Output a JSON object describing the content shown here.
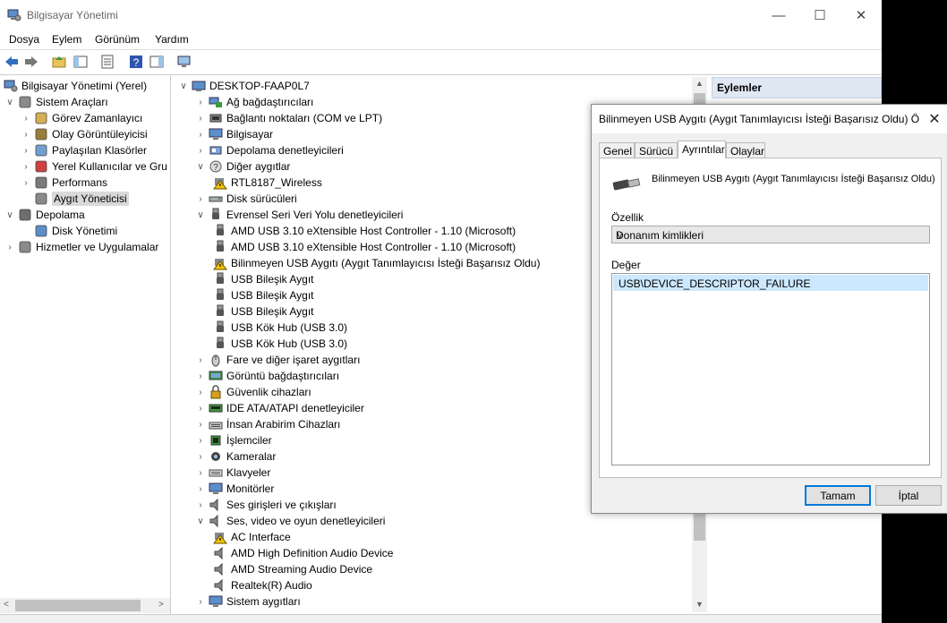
{
  "window": {
    "title": "Bilgisayar Yönetimi",
    "controls": {
      "minimize": "—",
      "maximize": "☐",
      "close": "✕"
    }
  },
  "menu": [
    "Dosya",
    "Eylem",
    "Görünüm",
    "Yardım"
  ],
  "tree": {
    "root": "Bilgisayar Yönetimi (Yerel)",
    "items": [
      {
        "label": "Sistem Araçları",
        "level": 1,
        "expanded": true
      },
      {
        "label": "Görev Zamanlayıcı",
        "level": 2
      },
      {
        "label": "Olay Görüntüleyicisi",
        "level": 2
      },
      {
        "label": "Paylaşılan Klasörler",
        "level": 2
      },
      {
        "label": "Yerel Kullanıcılar ve Gru",
        "level": 2
      },
      {
        "label": "Performans",
        "level": 2
      },
      {
        "label": "Aygıt Yöneticisi",
        "level": 2,
        "selected": true
      },
      {
        "label": "Depolama",
        "level": 1,
        "expanded": true
      },
      {
        "label": "Disk Yönetimi",
        "level": 2
      },
      {
        "label": "Hizmetler ve Uygulamalar",
        "level": 1
      }
    ]
  },
  "devices": {
    "computer": "DESKTOP-FAAP0L7",
    "rows": [
      {
        "label": "Ağ bağdaştırıcıları",
        "indent": 1,
        "arrow": ">",
        "icon": "network"
      },
      {
        "label": "Bağlantı noktaları (COM ve LPT)",
        "indent": 1,
        "arrow": ">",
        "icon": "port"
      },
      {
        "label": "Bilgisayar",
        "indent": 1,
        "arrow": ">",
        "icon": "monitor"
      },
      {
        "label": "Depolama denetleyicileri",
        "indent": 1,
        "arrow": ">",
        "icon": "storage"
      },
      {
        "label": "Diğer aygıtlar",
        "indent": 1,
        "arrow": "v",
        "icon": "unknown"
      },
      {
        "label": "RTL8187_Wireless",
        "indent": 2,
        "arrow": "",
        "icon": "warning"
      },
      {
        "label": "Disk sürücüleri",
        "indent": 1,
        "arrow": ">",
        "icon": "disk"
      },
      {
        "label": "Evrensel Seri Veri Yolu denetleyicileri",
        "indent": 1,
        "arrow": "v",
        "icon": "usb"
      },
      {
        "label": "AMD USB 3.10 eXtensible Host Controller - 1.10 (Microsoft)",
        "indent": 2,
        "arrow": "",
        "icon": "usb"
      },
      {
        "label": "AMD USB 3.10 eXtensible Host Controller - 1.10 (Microsoft)",
        "indent": 2,
        "arrow": "",
        "icon": "usb"
      },
      {
        "label": "Bilinmeyen USB Aygıtı (Aygıt Tanımlayıcısı İsteği Başarısız Oldu)",
        "indent": 2,
        "arrow": "",
        "icon": "warning"
      },
      {
        "label": "USB Bileşik Aygıt",
        "indent": 2,
        "arrow": "",
        "icon": "usb"
      },
      {
        "label": "USB Bileşik Aygıt",
        "indent": 2,
        "arrow": "",
        "icon": "usb"
      },
      {
        "label": "USB Bileşik Aygıt",
        "indent": 2,
        "arrow": "",
        "icon": "usb"
      },
      {
        "label": "USB Kök Hub (USB 3.0)",
        "indent": 2,
        "arrow": "",
        "icon": "usb"
      },
      {
        "label": "USB Kök Hub (USB 3.0)",
        "indent": 2,
        "arrow": "",
        "icon": "usb"
      },
      {
        "label": "Fare ve diğer işaret aygıtları",
        "indent": 1,
        "arrow": ">",
        "icon": "mouse"
      },
      {
        "label": "Görüntü bağdaştırıcıları",
        "indent": 1,
        "arrow": ">",
        "icon": "display"
      },
      {
        "label": "Güvenlik cihazları",
        "indent": 1,
        "arrow": ">",
        "icon": "security"
      },
      {
        "label": "IDE ATA/ATAPI denetleyiciler",
        "indent": 1,
        "arrow": ">",
        "icon": "ide"
      },
      {
        "label": "İnsan Arabirim Cihazları",
        "indent": 1,
        "arrow": ">",
        "icon": "hid"
      },
      {
        "label": "İşlemciler",
        "indent": 1,
        "arrow": ">",
        "icon": "cpu"
      },
      {
        "label": "Kameralar",
        "indent": 1,
        "arrow": ">",
        "icon": "camera"
      },
      {
        "label": "Klavyeler",
        "indent": 1,
        "arrow": ">",
        "icon": "keyboard"
      },
      {
        "label": "Monitörler",
        "indent": 1,
        "arrow": ">",
        "icon": "monitor"
      },
      {
        "label": "Ses girişleri ve çıkışları",
        "indent": 1,
        "arrow": ">",
        "icon": "speaker"
      },
      {
        "label": "Ses, video ve oyun denetleyicileri",
        "indent": 1,
        "arrow": "v",
        "icon": "speaker"
      },
      {
        "label": "AC Interface",
        "indent": 2,
        "arrow": "",
        "icon": "warning"
      },
      {
        "label": "AMD High Definition Audio Device",
        "indent": 2,
        "arrow": "",
        "icon": "speaker"
      },
      {
        "label": "AMD Streaming Audio Device",
        "indent": 2,
        "arrow": "",
        "icon": "speaker"
      },
      {
        "label": "Realtek(R) Audio",
        "indent": 2,
        "arrow": "",
        "icon": "speaker"
      },
      {
        "label": "Sistem aygıtları",
        "indent": 1,
        "arrow": ">",
        "icon": "monitor"
      }
    ]
  },
  "actions": {
    "header": "Eylemler"
  },
  "dialog": {
    "title": "Bilinmeyen USB Aygıtı (Aygıt Tanımlayıcısı İsteği Başarısız Oldu) Ö...",
    "close": "✕",
    "tabs": [
      "Genel",
      "Sürücü",
      "Ayrıntılar",
      "Olaylar"
    ],
    "active_tab": "Ayrıntılar",
    "device_name": "Bilinmeyen USB Aygıtı (Aygıt Tanımlayıcısı İsteği Başarısız Oldu)",
    "property_label": "Özellik",
    "property_value": "Donanım kimlikleri",
    "value_label": "Değer",
    "values": [
      "USB\\DEVICE_DESCRIPTOR_FAILURE"
    ],
    "ok": "Tamam",
    "cancel": "İptal"
  }
}
